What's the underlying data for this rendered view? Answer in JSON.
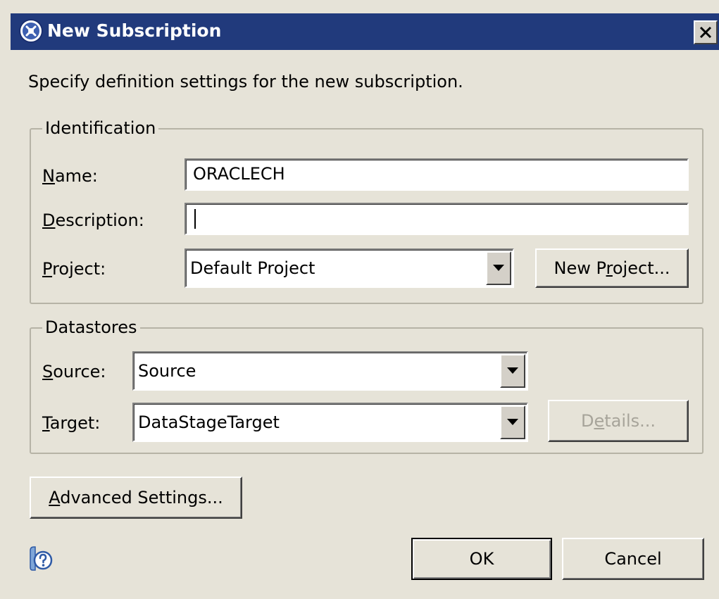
{
  "window": {
    "title": "New Subscription"
  },
  "instruction": "Specify definition settings for the new subscription.",
  "identification": {
    "legend": "Identification",
    "name_label_mnemonic": "N",
    "name_label_rest": "ame:",
    "name_value": "ORACLECH",
    "description_label_mnemonic": "D",
    "description_label_rest": "escription:",
    "description_value": "",
    "project_label_mnemonic": "P",
    "project_label_rest": "roject:",
    "project_selected": "Default Project",
    "new_project_pre": "New P",
    "new_project_mnemonic": "r",
    "new_project_post": "oject..."
  },
  "datastores": {
    "legend": "Datastores",
    "source_label_mnemonic": "S",
    "source_label_rest": "ource:",
    "source_selected": "Source",
    "target_label_mnemonic": "T",
    "target_label_rest": "arget:",
    "target_selected": "DataStageTarget",
    "details_pre": "D",
    "details_mnemonic": "e",
    "details_post": "tails..."
  },
  "advanced_button": {
    "mnemonic": "A",
    "rest": "dvanced Settings..."
  },
  "footer": {
    "ok_label": "OK",
    "cancel_label": "Cancel"
  },
  "colors": {
    "titlebar": "#213a7c",
    "dialog_bg": "#e6e3d8",
    "disabled_text": "#a7a49a"
  }
}
